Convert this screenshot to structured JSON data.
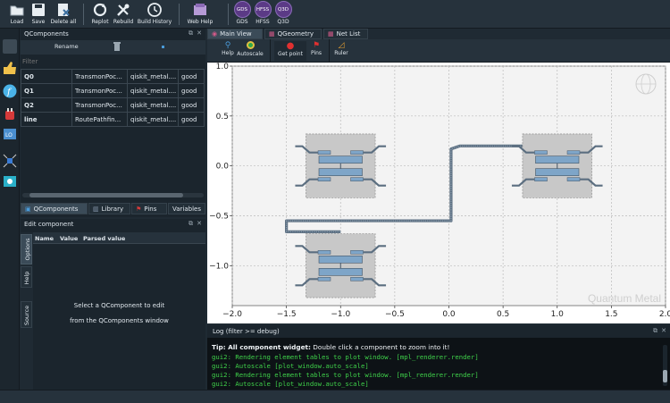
{
  "toolbar": {
    "load": "Load",
    "save": "Save",
    "delete_all": "Delete all",
    "replot": "Replot",
    "rebuild": "Rebuild",
    "build_history": "Build History",
    "web_help": "Web Help",
    "gds": "GDS",
    "hfss": "HFSS",
    "q3d": "Q3D"
  },
  "qcomponents": {
    "title": "QComponents",
    "rename": "Rename",
    "filter_placeholder": "Filter",
    "rows": [
      {
        "name": "Q0",
        "class": "TransmonPoc...",
        "module": "qiskit_metal....",
        "status": "good"
      },
      {
        "name": "Q1",
        "class": "TransmonPoc...",
        "module": "qiskit_metal....",
        "status": "good"
      },
      {
        "name": "Q2",
        "class": "TransmonPoc...",
        "module": "qiskit_metal....",
        "status": "good"
      },
      {
        "name": "line",
        "class": "RoutePathfin...",
        "module": "qiskit_metal....",
        "status": "good"
      }
    ],
    "tabs": [
      "QComponents",
      "Library",
      "Pins",
      "Variables"
    ]
  },
  "edit_component": {
    "title": "Edit component",
    "columns": [
      "Name",
      "Value",
      "Parsed value"
    ],
    "side_tabs": [
      "Options",
      "Help",
      "Source"
    ],
    "message_line1": "Select a QComponent to edit",
    "message_line2": "from the QComponents window"
  },
  "main_tabs": [
    "Main View",
    "QGeometry",
    "Net List"
  ],
  "plot_toolbar": {
    "help": "Help",
    "autoscale": "Autoscale",
    "get_point": "Get point",
    "pins": "Pins",
    "ruler": "Ruler"
  },
  "plot": {
    "watermark": "Quantum Metal",
    "x_ticks": [
      "−2.0",
      "−1.5",
      "−1.0",
      "−0.5",
      "0.0",
      "0.5",
      "1.0",
      "1.5",
      "2.0"
    ],
    "y_ticks": [
      "1.0",
      "0.5",
      "0.0",
      "−0.5",
      "−1.0"
    ]
  },
  "chart_data": {
    "type": "scatter",
    "xlim": [
      -2.0,
      2.0
    ],
    "ylim": [
      -1.4,
      1.0
    ],
    "grid": true,
    "qubits": [
      {
        "name": "Q0",
        "x": -1.0,
        "y": 0.0
      },
      {
        "name": "Q1",
        "x": 1.0,
        "y": 0.0
      },
      {
        "name": "Q2",
        "x": -1.0,
        "y": -1.0
      }
    ]
  },
  "log": {
    "title": "Log  (filter >= debug)",
    "tip_bold": "Tip: All component widget:",
    "tip_rest": " Double click a component to zoom into it!",
    "lines": [
      "gui2: Rendering element tables to plot window. [mpl_renderer.render]",
      "gui2: Autoscale [plot_window.auto_scale]",
      "gui2: Rendering element tables to plot window. [mpl_renderer.render]",
      "gui2: Autoscale [plot_window.auto_scale]"
    ]
  },
  "colors": {
    "accent": "#3b6fa0",
    "log_green": "#3fd24a",
    "qubit_pad": "#7ea5c8",
    "qubit_bg": "#c8c8c8"
  }
}
